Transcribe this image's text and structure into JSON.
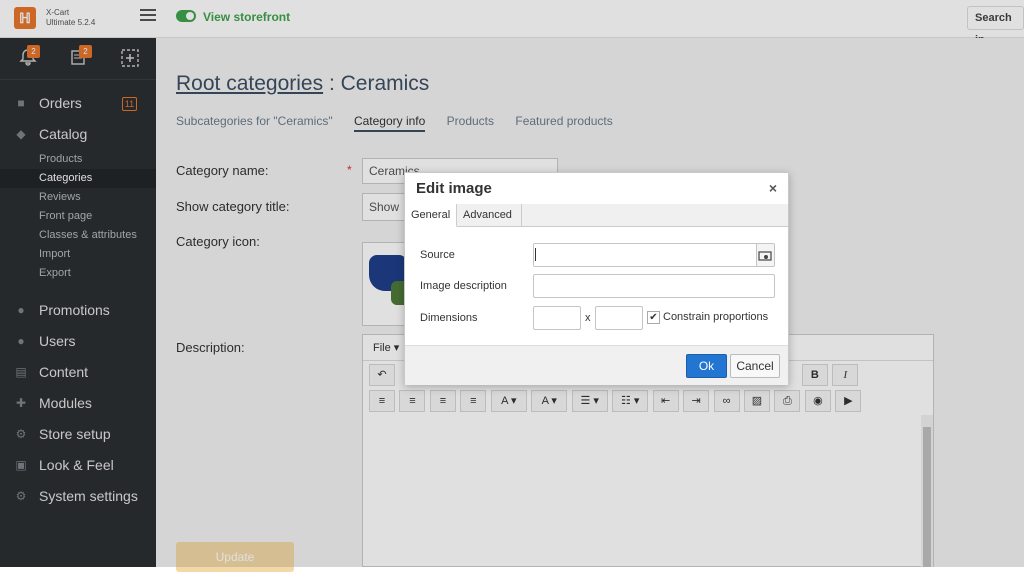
{
  "topbar": {
    "logo_glyph": "ℍ",
    "brand_line1": "X-Cart",
    "brand_line2": "Ultimate 5.2.4",
    "storefront_label": "View storefront",
    "search_label": "Search in",
    "accent_color": "#e8772e",
    "toggle_color": "#3fa34d"
  },
  "quick": {
    "bell_badge": "2",
    "orders_badge": "2"
  },
  "sidebar": {
    "items": [
      {
        "label": "Orders",
        "badge": "11",
        "icon": "orders-icon"
      },
      {
        "label": "Catalog",
        "icon": "tag-icon"
      },
      {
        "label": "Promotions",
        "icon": "promotions-icon"
      },
      {
        "label": "Users",
        "icon": "users-icon"
      },
      {
        "label": "Content",
        "icon": "content-icon"
      },
      {
        "label": "Modules",
        "icon": "modules-icon"
      },
      {
        "label": "Store setup",
        "icon": "store-icon"
      },
      {
        "label": "Look & Feel",
        "icon": "image-icon"
      },
      {
        "label": "System settings",
        "icon": "gear-icon"
      }
    ],
    "catalog_sub": [
      "Products",
      "Categories",
      "Reviews",
      "Front page",
      "Classes & attributes",
      "Import",
      "Export"
    ],
    "active_sub": "Categories"
  },
  "page": {
    "root_link": "Root categories",
    "current": ": Ceramics",
    "tabs": [
      "Subcategories for \"Ceramics\"",
      "Category info",
      "Products",
      "Featured products"
    ],
    "active_tab": "Category info",
    "labels": {
      "name": "Category name:",
      "show_title": "Show category title:",
      "icon": "Category icon:",
      "description": "Description:"
    },
    "required_mark": "*",
    "name_value": "Ceramics",
    "show_title_value": "Show",
    "editor_menu": "File ▾",
    "update_label": "Update"
  },
  "modal": {
    "title": "Edit image",
    "close_glyph": "×",
    "tabs": [
      "General",
      "Advanced"
    ],
    "active_tab": "General",
    "source_label": "Source",
    "description_label": "Image description",
    "dimensions_label": "Dimensions",
    "x_sep": "x",
    "constrain_label": "Constrain proportions",
    "constrain_checked": true,
    "source_value": "",
    "description_value": "",
    "width_value": "",
    "height_value": "",
    "ok_label": "Ok",
    "cancel_label": "Cancel",
    "ok_color": "#2276d2"
  }
}
